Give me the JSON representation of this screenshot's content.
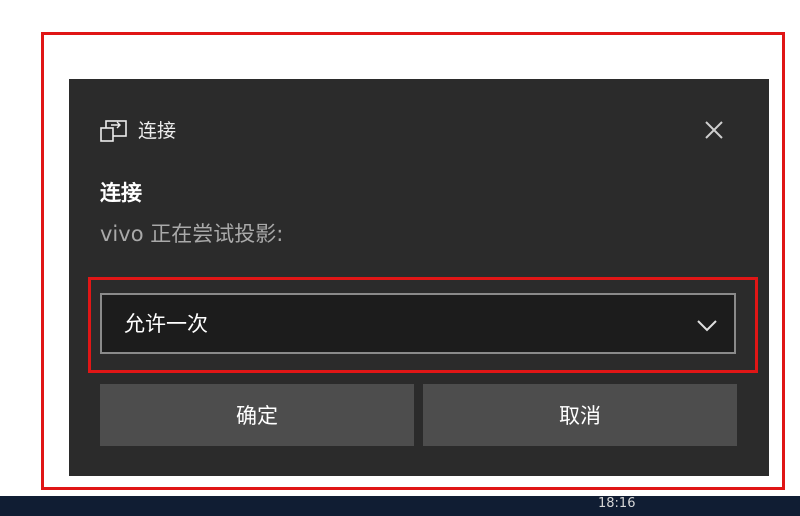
{
  "toast": {
    "app_name": "连接",
    "header_icon": "cast-project-icon",
    "close_icon": "close-icon",
    "title": "连接",
    "message": "vivo 正在尝试投影:",
    "dropdown": {
      "selected": "允许一次",
      "icon": "chevron-down-icon"
    },
    "buttons": {
      "confirm": "确定",
      "cancel": "取消"
    }
  },
  "taskbar": {
    "clock": "18:16"
  },
  "colors": {
    "toast_background": "#2b2b2b",
    "button_background": "#4d4d4d",
    "dropdown_background": "#1c1c1c",
    "highlight": "#e01616"
  }
}
